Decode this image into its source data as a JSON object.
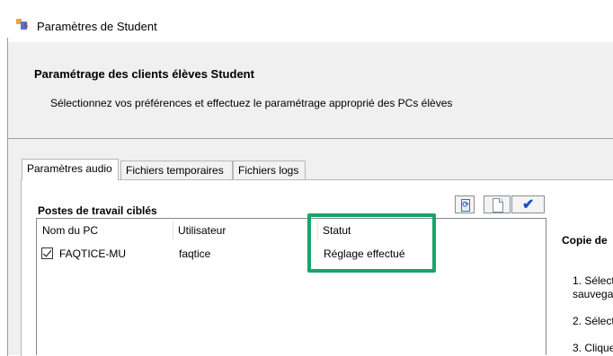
{
  "window": {
    "title": "Paramètres de Student"
  },
  "header": {
    "title": "Paramétrage des clients élèves Student",
    "subtitle": "Sélectionnez vos préférences et effectuez le paramétrage approprié des PCs élèves"
  },
  "tabs": [
    {
      "label": "Paramètres audio",
      "active": true
    },
    {
      "label": "Fichiers temporaires",
      "active": false
    },
    {
      "label": "Fichiers logs",
      "active": false
    }
  ],
  "section": {
    "title": "Postes de travail ciblés",
    "toolbar": {
      "refresh_icon": "refresh-icon",
      "document_icon": "document-icon",
      "apply_icon": "check-icon"
    }
  },
  "table": {
    "columns": [
      "Nom du PC",
      "Utilisateur",
      "Statut"
    ],
    "rows": [
      {
        "checked": true,
        "pc": "FAQTICE-MU",
        "user": "faqtice",
        "status": "Réglage effectué"
      }
    ]
  },
  "right_panel": {
    "title": "Copie de",
    "lines": [
      "1. Sélect",
      "sauvega",
      "2. Sélect",
      "3. Clique"
    ]
  },
  "colors": {
    "highlight": "#1aa36a",
    "band": "#f0f0f0"
  }
}
